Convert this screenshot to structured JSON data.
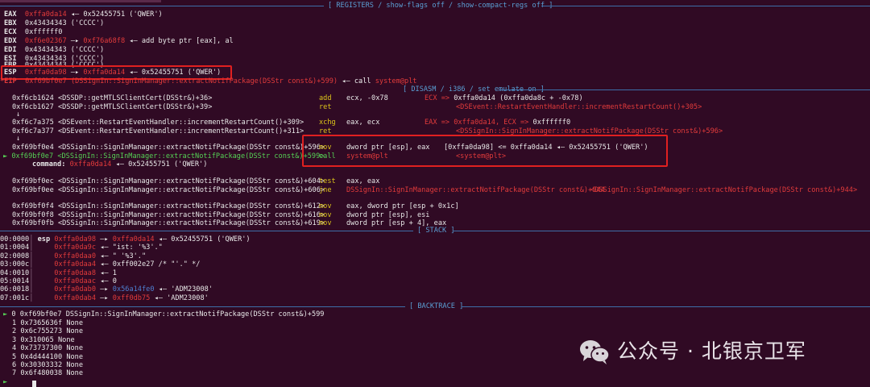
{
  "registers": {
    "header": "[ REGISTERS / show-flags off / show-compact-regs off ]",
    "eax": {
      "name": "EAX",
      "addr": "0xffa0da14",
      "arrow": "◂—",
      "val": "0x52455751 ('QWER')"
    },
    "ebx": {
      "name": "EBX",
      "val": "0x43434343 ('CCCC')"
    },
    "ecx": {
      "name": "ECX",
      "val": "0xffffff0"
    },
    "edx": {
      "name": "EDX",
      "addr": "0xf6e02367",
      "arrow": "—▸",
      "addr2": "0xf76a68f8",
      "arrow2": "◂—",
      "val": "add byte ptr [eax], al"
    },
    "edi": {
      "name": "EDI",
      "val": "0x43434343 ('CCCC')"
    },
    "esi": {
      "name": "ESI",
      "val": "0x43434343 ('CCCC')"
    },
    "ebp": {
      "name": "EBP",
      "val": "0x43434343 ('CCCC')"
    },
    "esp": {
      "name": "ESP",
      "addr": "0xffa0da98",
      "arrow": "—▸",
      "addr2": "0xffa0da14",
      "arrow2": "◂—",
      "val": "0x52455751 ('QWER')"
    },
    "eip": {
      "name": "*EIP",
      "addr": "0xf69bf0e7 (DSSignIn::SignInManager::extractNotifPackage(DSStr const&)+599)",
      "arrow": "◂—",
      "op": "call",
      "tgt": "system@plt"
    }
  },
  "disasm": {
    "header": "[ DISASM / i386 / set emulate on ]",
    "rows": [
      {
        "addr": "0xf6cb1624",
        "sym": "<DSSDP::getMTLSClientCert(DSStr&)+36>",
        "op": "add",
        "args": "ecx, -0x78",
        "cm1": "ECX =>",
        "cm2": "0xffa0da14 (0xffa0da8c + -0x78)"
      },
      {
        "addr": "0xf6cb1627",
        "sym": "<DSSDP::getMTLSClientCert(DSStr&)+39>",
        "op": "ret",
        "args": "",
        "cm1": "",
        "cm2": "<DSEvent::RestartEventHandler::incrementRestartCount()+305>"
      },
      {
        "addr": "0xf6c7a375",
        "sym": "<DSEvent::RestartEventHandler::incrementRestartCount()+309>",
        "op": "xchg",
        "args": "eax, ecx",
        "cm1": "EAX => 0xffa0da14, ECX =>",
        "cm2": "0xffffff0"
      },
      {
        "addr": "0xf6c7a377",
        "sym": "<DSEvent::RestartEventHandler::incrementRestartCount()+311>",
        "op": "ret",
        "args": "",
        "cm1": "",
        "cm2": "<DSSignIn::SignInManager::extractNotifPackage(DSStr const&)+596>"
      },
      {
        "addr": "0xf69bf0e4",
        "sym": "<DSSignIn::SignInManager::extractNotifPackage(DSStr const&)+596>",
        "op": "mov",
        "args": "dword ptr [esp], eax",
        "cm1": "[0xffa0da98] <= 0xffa0da14",
        "cm2": "◂— 0x52455751 ('QWER')"
      },
      {
        "addr": "0xf69bf0e7",
        "sym": "<DSSignIn::SignInManager::extractNotifPackage(DSStr const&)+599>",
        "op": "call",
        "args": "system@plt",
        "cm1": "",
        "cm2": "<system@plt>"
      },
      {
        "addr": "0xf69bf0ec",
        "sym": "<DSSignIn::SignInManager::extractNotifPackage(DSStr const&)+604>",
        "op": "test",
        "args": "eax, eax",
        "cm1": "",
        "cm2": ""
      },
      {
        "addr": "0xf69bf0ee",
        "sym": "<DSSignIn::SignInManager::extractNotifPackage(DSStr const&)+606>",
        "op": "jne",
        "args": "DSSignIn::SignInManager::extractNotifPackage(DSStr const&)+944",
        "cm1": "",
        "cm2": "<DSSignIn::SignInManager::extractNotifPackage(DSStr const&)+944>"
      },
      {
        "addr": "0xf69bf0f4",
        "sym": "<DSSignIn::SignInManager::extractNotifPackage(DSStr const&)+612>",
        "op": "mov",
        "args": "eax, dword ptr [esp + 0x1c]",
        "cm1": "",
        "cm2": ""
      },
      {
        "addr": "0xf69bf0f8",
        "sym": "<DSSignIn::SignInManager::extractNotifPackage(DSStr const&)+616>",
        "op": "mov",
        "args": "dword ptr [esp], esi",
        "cm1": "",
        "cm2": ""
      },
      {
        "addr": "0xf69bf0fb",
        "sym": "<DSSignIn::SignInManager::extractNotifPackage(DSStr const&)+619>",
        "op": "mov",
        "args": "dword ptr [esp + 4], eax",
        "cm1": "",
        "cm2": ""
      }
    ],
    "cur_marker": "►",
    "down_arrow": "↓",
    "command_label": "command:",
    "command_addr": "0xffa0da14",
    "command_arrow": "◂—",
    "command_val": "0x52455751 ('QWER')"
  },
  "stack": {
    "header": "[ STACK ]",
    "rows": [
      {
        "off": "00:0000",
        "reg": "esp",
        "addr": "0xffa0da98",
        "a1": "—▸",
        "p": "0xffa0da14",
        "a2": "◂—",
        "val": "0x52455751 ('QWER')",
        "vc": "wht"
      },
      {
        "off": "01:0004",
        "reg": "",
        "addr": "0xffa0da9c",
        "a1": "◂—",
        "p": "",
        "a2": "",
        "val": "\"ist: '%3'.\"",
        "vc": "wht"
      },
      {
        "off": "02:0008",
        "reg": "",
        "addr": "0xffa0daa0",
        "a1": "◂—",
        "p": "",
        "a2": "",
        "val": "\" '%3'.\"",
        "vc": "wht"
      },
      {
        "off": "03:000c",
        "reg": "",
        "addr": "0xffa0daa4",
        "a1": "◂—",
        "p": "",
        "a2": "",
        "val": "0xff002e27 /* \"'.\" */",
        "vc": "wht"
      },
      {
        "off": "04:0010",
        "reg": "",
        "addr": "0xffa0daa8",
        "a1": "◂—",
        "p": "",
        "a2": "",
        "val": "1",
        "vc": "wht"
      },
      {
        "off": "05:0014",
        "reg": "",
        "addr": "0xffa0daac",
        "a1": "◂—",
        "p": "",
        "a2": "",
        "val": "0",
        "vc": "wht"
      },
      {
        "off": "06:0018",
        "reg": "",
        "addr": "0xffa0dab0",
        "a1": "—▸",
        "p": "0x56a14fe0",
        "a2": "◂—",
        "val": "'ADM23008'",
        "vc": "wht"
      },
      {
        "off": "07:001c",
        "reg": "",
        "addr": "0xffa0dab4",
        "a1": "—▸",
        "p": "0xff0db75",
        "a2": "◂—",
        "val": "'ADM23008'",
        "vc": "wht"
      }
    ]
  },
  "backtrace": {
    "header": "[ BACKTRACE ]",
    "rows": [
      {
        "mark": "►",
        "idx": "0",
        "addr": "0xf69bf0e7",
        "sym": "DSSignIn::SignInManager::extractNotifPackage(DSStr const&)+599"
      },
      {
        "mark": "",
        "idx": "1",
        "addr": "0x7365636f",
        "sym": "None"
      },
      {
        "mark": "",
        "idx": "2",
        "addr": "0x6c755273",
        "sym": "None"
      },
      {
        "mark": "",
        "idx": "3",
        "addr": "0x310065",
        "sym": "None"
      },
      {
        "mark": "",
        "idx": "4",
        "addr": "0x73737300",
        "sym": "None"
      },
      {
        "mark": "",
        "idx": "5",
        "addr": "0x4d444100",
        "sym": "None"
      },
      {
        "mark": "",
        "idx": "6",
        "addr": "0x30303332",
        "sym": "None"
      },
      {
        "mark": "",
        "idx": "7",
        "addr": "0x6f480038",
        "sym": "None"
      }
    ]
  },
  "watermark": {
    "text": "公众号 · 北银京卫军",
    "icon": "wechat-icon"
  },
  "colors": {
    "background": "#300a24",
    "red": "#e23b3b",
    "yellow": "#ddc51a",
    "green": "#55d255",
    "magenta": "#c658c6",
    "blue": "#4d7fd0",
    "highlight_box": "#e02020"
  }
}
